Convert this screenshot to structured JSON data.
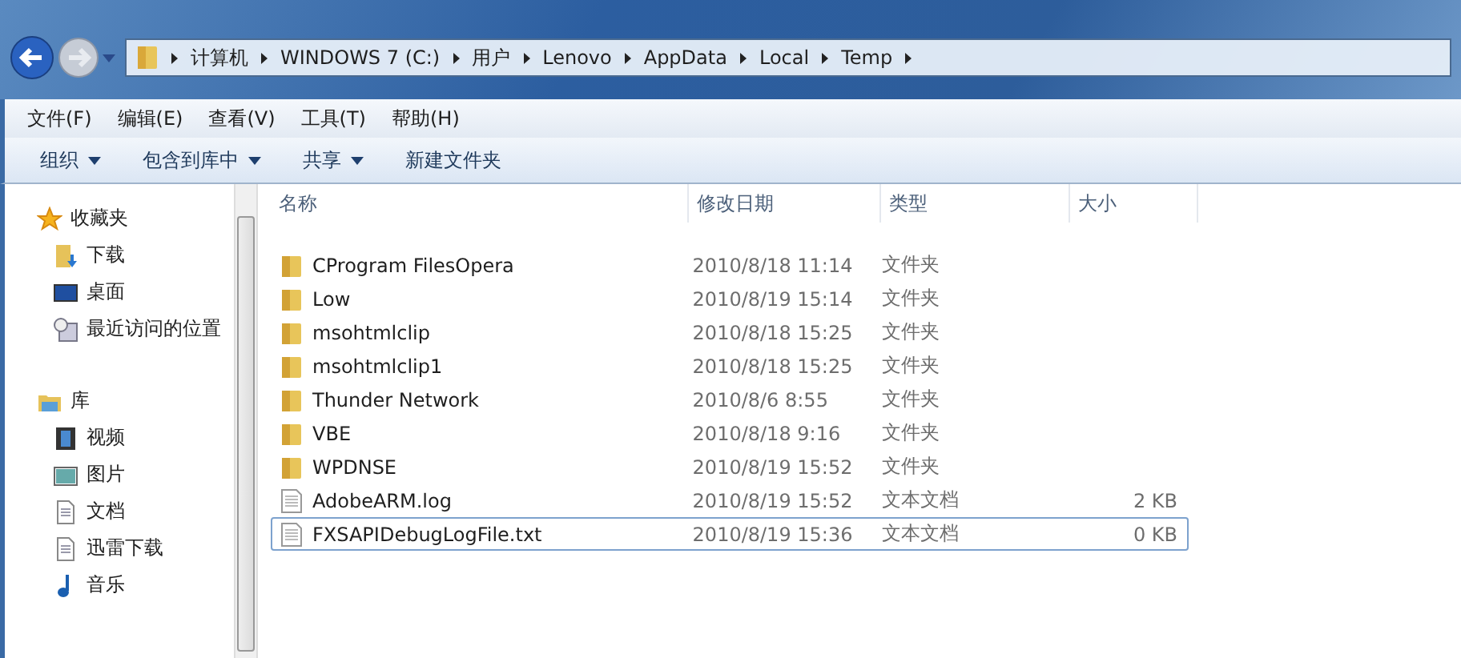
{
  "address_bar": {
    "crumbs": [
      "计算机",
      "WINDOWS 7 (C:)",
      "用户",
      "Lenovo",
      "AppData",
      "Local",
      "Temp"
    ]
  },
  "menu_bar": [
    "文件(F)",
    "编辑(E)",
    "查看(V)",
    "工具(T)",
    "帮助(H)"
  ],
  "toolbar": [
    {
      "label": "组织",
      "dropdown": true
    },
    {
      "label": "包含到库中",
      "dropdown": true
    },
    {
      "label": "共享",
      "dropdown": true
    },
    {
      "label": "新建文件夹",
      "dropdown": false
    }
  ],
  "sidebar": {
    "groups": [
      {
        "label": "收藏夹",
        "kind": "star",
        "items": [
          {
            "label": "下载",
            "kind": "download"
          },
          {
            "label": "桌面",
            "kind": "desktop"
          },
          {
            "label": "最近访问的位置",
            "kind": "recent"
          }
        ]
      },
      {
        "label": "库",
        "kind": "library",
        "items": [
          {
            "label": "视频",
            "kind": "video"
          },
          {
            "label": "图片",
            "kind": "picture"
          },
          {
            "label": "文档",
            "kind": "document"
          },
          {
            "label": "迅雷下载",
            "kind": "document"
          },
          {
            "label": "音乐",
            "kind": "music"
          }
        ]
      }
    ]
  },
  "table": {
    "columns": [
      "名称",
      "修改日期",
      "类型",
      "大小"
    ],
    "rows": [
      {
        "name": "CProgram FilesOpera",
        "date": "2010/8/18 11:14",
        "type": "文件夹",
        "kind": "folder",
        "focused": false
      },
      {
        "name": "Low",
        "date": "2010/8/19 15:14",
        "type": "文件夹",
        "kind": "folder",
        "focused": false
      },
      {
        "name": "msohtmlclip",
        "date": "2010/8/18 15:25",
        "type": "文件夹",
        "kind": "folder",
        "focused": false
      },
      {
        "name": "msohtmlclip1",
        "date": "2010/8/18 15:25",
        "type": "文件夹",
        "kind": "folder",
        "focused": false
      },
      {
        "name": "Thunder Network",
        "date": "2010/8/6 8:55",
        "type": "文件夹",
        "kind": "folder",
        "focused": false
      },
      {
        "name": "VBE",
        "date": "2010/8/18 9:16",
        "type": "文件夹",
        "kind": "folder",
        "focused": false
      },
      {
        "name": "WPDNSE",
        "date": "2010/8/19 15:52",
        "type": "文件夹",
        "kind": "folder",
        "focused": false
      },
      {
        "name": "AdobeARM.log",
        "date": "2010/8/19 15:52",
        "type": "文本文档",
        "size": "2 KB",
        "kind": "text",
        "focused": false
      },
      {
        "name": "FXSAPIDebugLogFile.txt",
        "date": "2010/8/19 15:36",
        "type": "文本文档",
        "size": "0 KB",
        "kind": "text",
        "focused": true
      }
    ]
  }
}
